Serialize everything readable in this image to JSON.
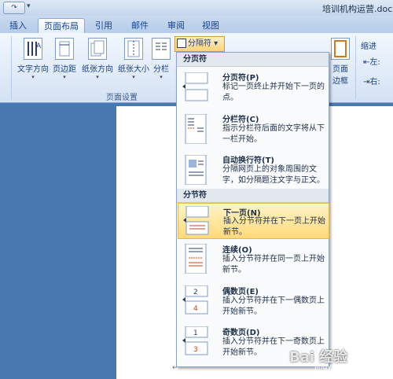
{
  "title_bar": {
    "redo_label": "↷",
    "more_label": "▾",
    "doc_title": "培训机构运营.doc ["
  },
  "tabs": [
    {
      "label": "插入"
    },
    {
      "label": "页面布局"
    },
    {
      "label": "引用"
    },
    {
      "label": "邮件"
    },
    {
      "label": "审阅"
    },
    {
      "label": "视图"
    }
  ],
  "ribbon": {
    "buttons": [
      {
        "label": "文字方向",
        "arrow": "▾"
      },
      {
        "label": "页边距",
        "arrow": "▾"
      },
      {
        "label": "纸张方向",
        "arrow": "▾"
      },
      {
        "label": "纸张大小",
        "arrow": "▾"
      },
      {
        "label": "分栏",
        "arrow": "▾"
      }
    ],
    "group_label": "页面设置",
    "split_button_label": "分隔符 ▾",
    "page_border_label": "页面\n边框",
    "page_border_line1": "页面",
    "page_border_line2": "边框",
    "indent_label": "缩进",
    "indent_left": "左:",
    "indent_right": "右:"
  },
  "menu": {
    "section_page": "分页符",
    "section_section": "分节符",
    "items": [
      {
        "title": "分页符(P)",
        "desc": "标记一页终止并开始下一页的点。"
      },
      {
        "title": "分栏符(C)",
        "desc": "指示分栏符后面的文字将从下一栏开始。"
      },
      {
        "title": "自动换行符(T)",
        "desc": "分隔网页上的对象周围的文字，如分隔题注文字与正文。"
      },
      {
        "title": "下一页(N)",
        "desc": "插入分节符并在下一页上开始新节。"
      },
      {
        "title": "连续(O)",
        "desc": "插入分节符并在同一页上开始新节。"
      },
      {
        "title": "偶数页(E)",
        "desc": "插入分节符并在下一偶数页上开始新节。"
      },
      {
        "title": "奇数页(D)",
        "desc": "插入分节符并在下一奇数页上开始新节。"
      }
    ]
  },
  "document": {
    "cursor_mark": "↵"
  },
  "watermark": {
    "text": "Bai 经验",
    "sub": "jingyan.baidu.com"
  },
  "colors": {
    "accent": "#15428b",
    "highlight": "#ffd97a"
  }
}
